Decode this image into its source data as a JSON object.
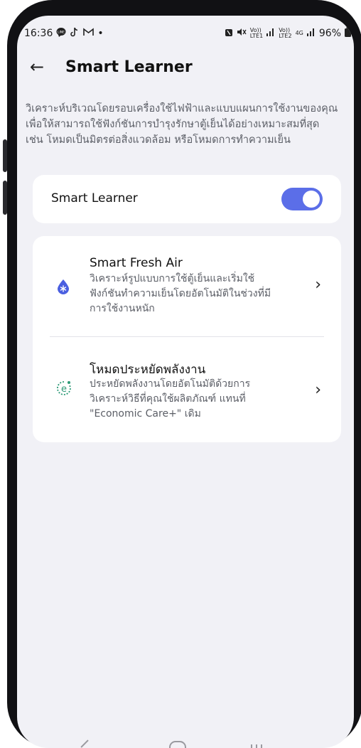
{
  "status_bar": {
    "time": "16:36",
    "left_icons": [
      "line-icon",
      "tiktok-icon",
      "gmail-icon"
    ],
    "dot": "•",
    "volte1": "Vo))",
    "lte1": "LTE1",
    "volte2": "Vo))",
    "lte2": "LTE2",
    "network": "4G",
    "battery": "96%"
  },
  "header": {
    "back_icon": "arrow-left-icon",
    "title": "Smart Learner"
  },
  "description": "วิเคราะห์บริเวณโดยรอบเครื่องใช้ไฟฟ้าและแบบแผนการใช้งานของคุณ เพื่อให้สามารถใช้ฟังก์ชันการบำรุงรักษาตู้เย็นได้อย่างเหมาะสมที่สุด เช่น โหมดเป็นมิตรต่อสิ่งแวดล้อม หรือโหมดการทำความเย็น",
  "toggle": {
    "label": "Smart Learner",
    "state": "on",
    "accent": "#5b6ee8"
  },
  "items": [
    {
      "icon": "snowflake-drop-icon",
      "title": "Smart Fresh Air",
      "subtitle": "วิเคราะห์รูปแบบการใช้ตู้เย็นและเริ่มใช้ฟังก์ชันทำความเย็นโดยอัตโนมัติในช่วงที่มีการใช้งานหนัก",
      "chevron": "›"
    },
    {
      "icon": "eco-e-icon",
      "title": "โหมดประหยัดพลังงาน",
      "subtitle": "ประหยัดพลังงานโดยอัตโนมัติด้วยการวิเคราะห์วิธีที่คุณใช้ผลิตภัณฑ์ แทนที่ \"Economic Care+\" เดิม",
      "chevron": "›"
    }
  ]
}
